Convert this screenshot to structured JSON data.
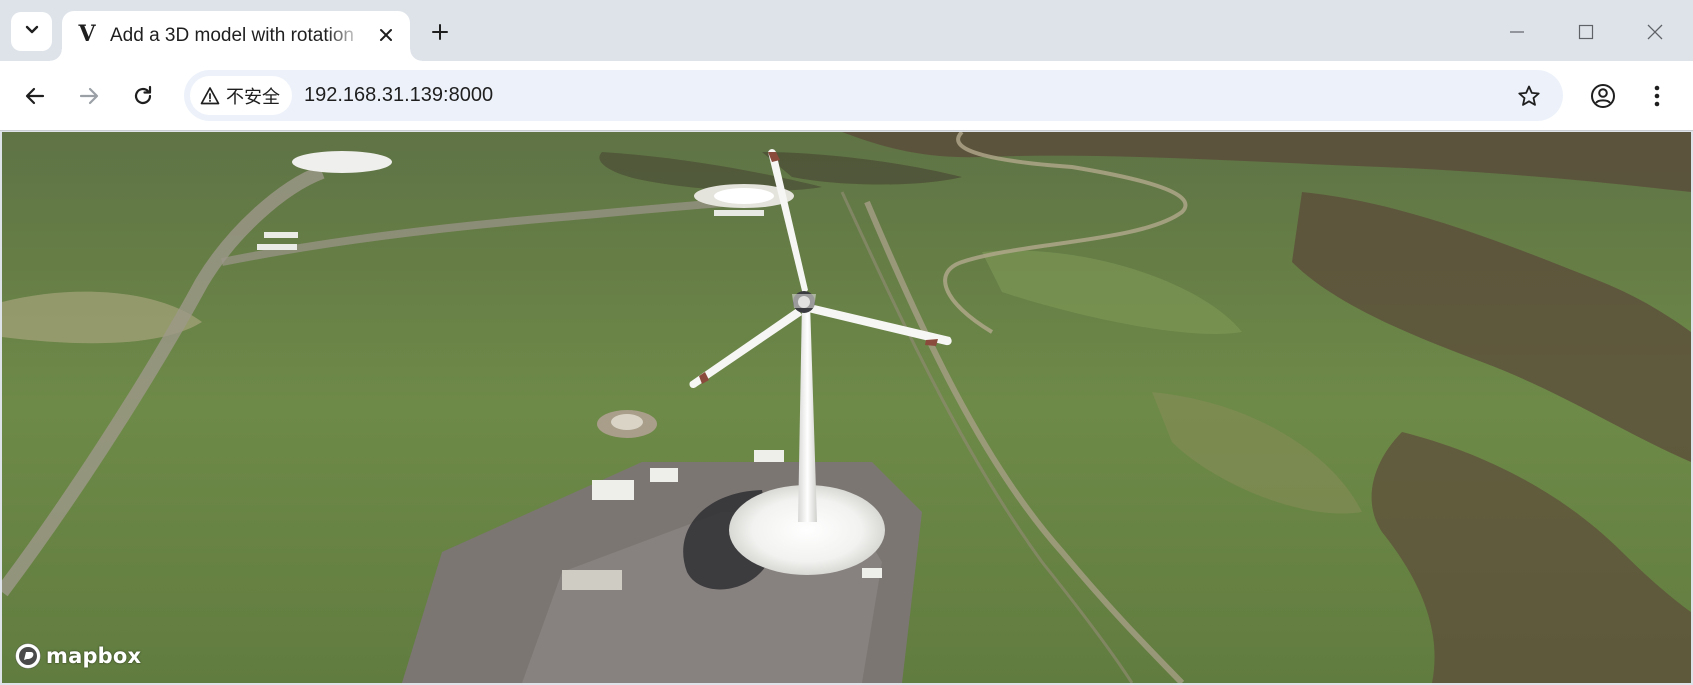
{
  "browser": {
    "tab": {
      "favicon_letter": "V",
      "title": "Add a 3D model with rotation"
    },
    "new_tab_symbol": "+",
    "address_bar": {
      "security_label": "不安全",
      "url": "192.168.31.139:8000"
    }
  },
  "map": {
    "attribution_logo_text": "mapbox"
  },
  "icons": {
    "tab_search": "chevron-down-icon",
    "close_tab": "close-icon",
    "new_tab": "plus-icon",
    "minimize": "minimize-icon",
    "maximize": "maximize-icon",
    "close_window": "close-icon",
    "back": "arrow-left-icon",
    "forward": "arrow-right-icon",
    "reload": "reload-icon",
    "security": "warning-triangle-icon",
    "bookmark": "star-icon",
    "profile": "account-circle-icon",
    "menu": "more-vert-icon",
    "map_logo": "mapbox-logo-icon"
  },
  "colors": {
    "tabstrip_bg": "#dee3ea",
    "toolbar_bg": "#ffffff",
    "omnibox_bg": "#edf2fa",
    "icon": "#1f1f1f",
    "disabled_icon": "#9aa0a6",
    "grass": "#6f8a4a",
    "turbine": "#f4f4f2",
    "blade_tip": "#8a4a3c"
  }
}
